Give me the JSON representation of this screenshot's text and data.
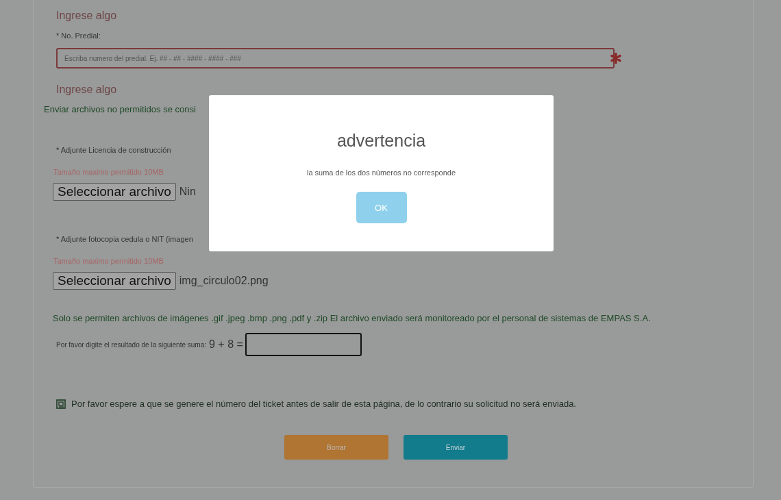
{
  "previous_field_error": "Ingrese algo",
  "predial": {
    "label": "* No. Predial:",
    "placeholder": "Escriba numero del predial. Ej. ## - ## - #### - #### - ###",
    "invalid": true,
    "error": "Ingrese algo"
  },
  "warning_notice": "Enviar archivos no permitidos se consi",
  "uploads": [
    {
      "label": "* Adjunte Licencia de construcción",
      "size_note": "Tamaño maximo permitido 10MB",
      "button": "Seleccionar archivo",
      "file": "Nin"
    },
    {
      "label": "* Adjunte fotocopia cedula o NIT (imagen",
      "size_note": "Tamaño maximo permitido 10MB",
      "button": "Seleccionar archivo",
      "file": "img_circulo02.png"
    }
  ],
  "allowed_note": "Solo se permiten archivos de imágenes .gif .jpeg .bmp .png .pdf y .zip El archivo enviado será monitoreado por el personal de sistemas de EMPAS S.A.",
  "captcha": {
    "label": "Por favor digite el resultado de la siguiente suma:",
    "expression": "9 + 8 ="
  },
  "ticket_note": "Por favor espere a que se genere el número del ticket antes de salir de esta página, de lo contrario su solicitud no será enviada.",
  "buttons": [
    {
      "label": "Borrar",
      "kind": "reset"
    },
    {
      "label": "Enviar",
      "kind": "submit"
    }
  ],
  "dialog": {
    "title": "advertencia",
    "message": "la suma de los dos números no corresponde",
    "button": "OK"
  }
}
